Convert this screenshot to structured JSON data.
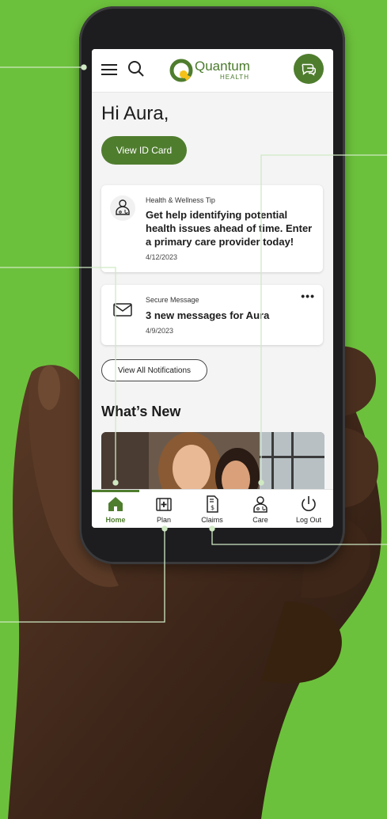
{
  "app": {
    "logo_name": "Quantum",
    "logo_sub": "HEALTH"
  },
  "home": {
    "greeting": "Hi Aura,",
    "id_card_button": "View ID Card",
    "notifications": [
      {
        "category": "Health & Wellness Tip",
        "headline": "Get help identifying potential health issues ahead of time. Enter a primary care provider today!",
        "date": "4/12/2023",
        "icon": "doctor-icon"
      },
      {
        "category": "Secure Message",
        "headline": "3 new messages for Aura",
        "date": "4/9/2023",
        "icon": "envelope-icon",
        "more": "•••"
      }
    ],
    "view_all_button": "View All Notifications",
    "whats_new_title": "What’s New"
  },
  "bottom_nav": [
    {
      "label": "Home",
      "icon": "home-icon",
      "active": true
    },
    {
      "label": "Plan",
      "icon": "plan-icon",
      "active": false
    },
    {
      "label": "Claims",
      "icon": "claims-icon",
      "active": false
    },
    {
      "label": "Care",
      "icon": "care-icon",
      "active": false
    },
    {
      "label": "Log Out",
      "icon": "power-icon",
      "active": false
    }
  ],
  "colors": {
    "background": "#6cc13c",
    "brand_green": "#4f7d2e",
    "logo_yellow": "#f5c21a"
  }
}
